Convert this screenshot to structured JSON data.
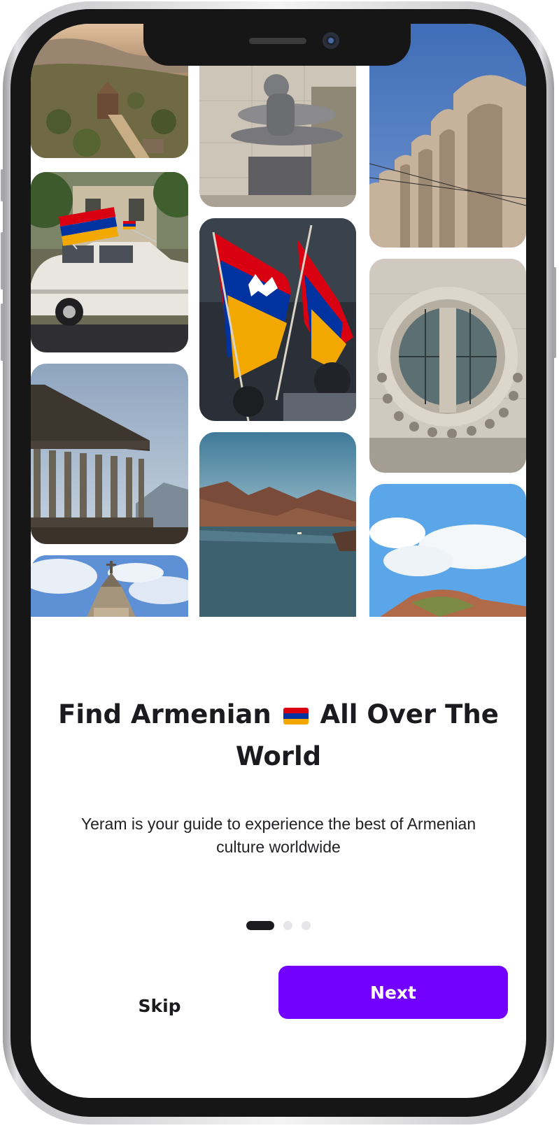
{
  "onboarding": {
    "title_part1": "Find Armenian",
    "title_part2": "All Over The World",
    "subtitle": "Yeram is your guide to experience the best of Armenian culture worldwide",
    "page_indicator": {
      "current": 1,
      "total": 3
    },
    "skip_label": "Skip",
    "next_label": "Next"
  },
  "colors": {
    "primary_button": "#7200ff",
    "indicator_active": "#1b1b1f",
    "indicator_inactive": "#e5e5ea",
    "flag": [
      "#d90012",
      "#0033a0",
      "#f2a800"
    ]
  },
  "gallery": [
    "aerial-village-photo",
    "car-with-flag-photo",
    "garni-temple-photo",
    "church-dome-photo",
    "metal-statue-photo",
    "waving-flags-photo",
    "mountain-lake-photo",
    "stone-arches-photo",
    "round-window-monument-photo",
    "sky-mountain-photo"
  ]
}
